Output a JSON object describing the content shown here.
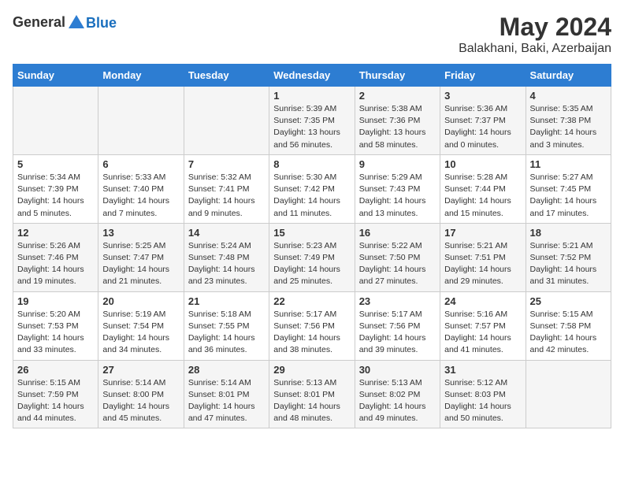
{
  "header": {
    "logo_general": "General",
    "logo_blue": "Blue",
    "month": "May 2024",
    "location": "Balakhani, Baki, Azerbaijan"
  },
  "days_of_week": [
    "Sunday",
    "Monday",
    "Tuesday",
    "Wednesday",
    "Thursday",
    "Friday",
    "Saturday"
  ],
  "weeks": [
    [
      {
        "day": "",
        "info": ""
      },
      {
        "day": "",
        "info": ""
      },
      {
        "day": "",
        "info": ""
      },
      {
        "day": "1",
        "info": "Sunrise: 5:39 AM\nSunset: 7:35 PM\nDaylight: 13 hours\nand 56 minutes."
      },
      {
        "day": "2",
        "info": "Sunrise: 5:38 AM\nSunset: 7:36 PM\nDaylight: 13 hours\nand 58 minutes."
      },
      {
        "day": "3",
        "info": "Sunrise: 5:36 AM\nSunset: 7:37 PM\nDaylight: 14 hours\nand 0 minutes."
      },
      {
        "day": "4",
        "info": "Sunrise: 5:35 AM\nSunset: 7:38 PM\nDaylight: 14 hours\nand 3 minutes."
      }
    ],
    [
      {
        "day": "5",
        "info": "Sunrise: 5:34 AM\nSunset: 7:39 PM\nDaylight: 14 hours\nand 5 minutes."
      },
      {
        "day": "6",
        "info": "Sunrise: 5:33 AM\nSunset: 7:40 PM\nDaylight: 14 hours\nand 7 minutes."
      },
      {
        "day": "7",
        "info": "Sunrise: 5:32 AM\nSunset: 7:41 PM\nDaylight: 14 hours\nand 9 minutes."
      },
      {
        "day": "8",
        "info": "Sunrise: 5:30 AM\nSunset: 7:42 PM\nDaylight: 14 hours\nand 11 minutes."
      },
      {
        "day": "9",
        "info": "Sunrise: 5:29 AM\nSunset: 7:43 PM\nDaylight: 14 hours\nand 13 minutes."
      },
      {
        "day": "10",
        "info": "Sunrise: 5:28 AM\nSunset: 7:44 PM\nDaylight: 14 hours\nand 15 minutes."
      },
      {
        "day": "11",
        "info": "Sunrise: 5:27 AM\nSunset: 7:45 PM\nDaylight: 14 hours\nand 17 minutes."
      }
    ],
    [
      {
        "day": "12",
        "info": "Sunrise: 5:26 AM\nSunset: 7:46 PM\nDaylight: 14 hours\nand 19 minutes."
      },
      {
        "day": "13",
        "info": "Sunrise: 5:25 AM\nSunset: 7:47 PM\nDaylight: 14 hours\nand 21 minutes."
      },
      {
        "day": "14",
        "info": "Sunrise: 5:24 AM\nSunset: 7:48 PM\nDaylight: 14 hours\nand 23 minutes."
      },
      {
        "day": "15",
        "info": "Sunrise: 5:23 AM\nSunset: 7:49 PM\nDaylight: 14 hours\nand 25 minutes."
      },
      {
        "day": "16",
        "info": "Sunrise: 5:22 AM\nSunset: 7:50 PM\nDaylight: 14 hours\nand 27 minutes."
      },
      {
        "day": "17",
        "info": "Sunrise: 5:21 AM\nSunset: 7:51 PM\nDaylight: 14 hours\nand 29 minutes."
      },
      {
        "day": "18",
        "info": "Sunrise: 5:21 AM\nSunset: 7:52 PM\nDaylight: 14 hours\nand 31 minutes."
      }
    ],
    [
      {
        "day": "19",
        "info": "Sunrise: 5:20 AM\nSunset: 7:53 PM\nDaylight: 14 hours\nand 33 minutes."
      },
      {
        "day": "20",
        "info": "Sunrise: 5:19 AM\nSunset: 7:54 PM\nDaylight: 14 hours\nand 34 minutes."
      },
      {
        "day": "21",
        "info": "Sunrise: 5:18 AM\nSunset: 7:55 PM\nDaylight: 14 hours\nand 36 minutes."
      },
      {
        "day": "22",
        "info": "Sunrise: 5:17 AM\nSunset: 7:56 PM\nDaylight: 14 hours\nand 38 minutes."
      },
      {
        "day": "23",
        "info": "Sunrise: 5:17 AM\nSunset: 7:56 PM\nDaylight: 14 hours\nand 39 minutes."
      },
      {
        "day": "24",
        "info": "Sunrise: 5:16 AM\nSunset: 7:57 PM\nDaylight: 14 hours\nand 41 minutes."
      },
      {
        "day": "25",
        "info": "Sunrise: 5:15 AM\nSunset: 7:58 PM\nDaylight: 14 hours\nand 42 minutes."
      }
    ],
    [
      {
        "day": "26",
        "info": "Sunrise: 5:15 AM\nSunset: 7:59 PM\nDaylight: 14 hours\nand 44 minutes."
      },
      {
        "day": "27",
        "info": "Sunrise: 5:14 AM\nSunset: 8:00 PM\nDaylight: 14 hours\nand 45 minutes."
      },
      {
        "day": "28",
        "info": "Sunrise: 5:14 AM\nSunset: 8:01 PM\nDaylight: 14 hours\nand 47 minutes."
      },
      {
        "day": "29",
        "info": "Sunrise: 5:13 AM\nSunset: 8:01 PM\nDaylight: 14 hours\nand 48 minutes."
      },
      {
        "day": "30",
        "info": "Sunrise: 5:13 AM\nSunset: 8:02 PM\nDaylight: 14 hours\nand 49 minutes."
      },
      {
        "day": "31",
        "info": "Sunrise: 5:12 AM\nSunset: 8:03 PM\nDaylight: 14 hours\nand 50 minutes."
      },
      {
        "day": "",
        "info": ""
      }
    ]
  ]
}
